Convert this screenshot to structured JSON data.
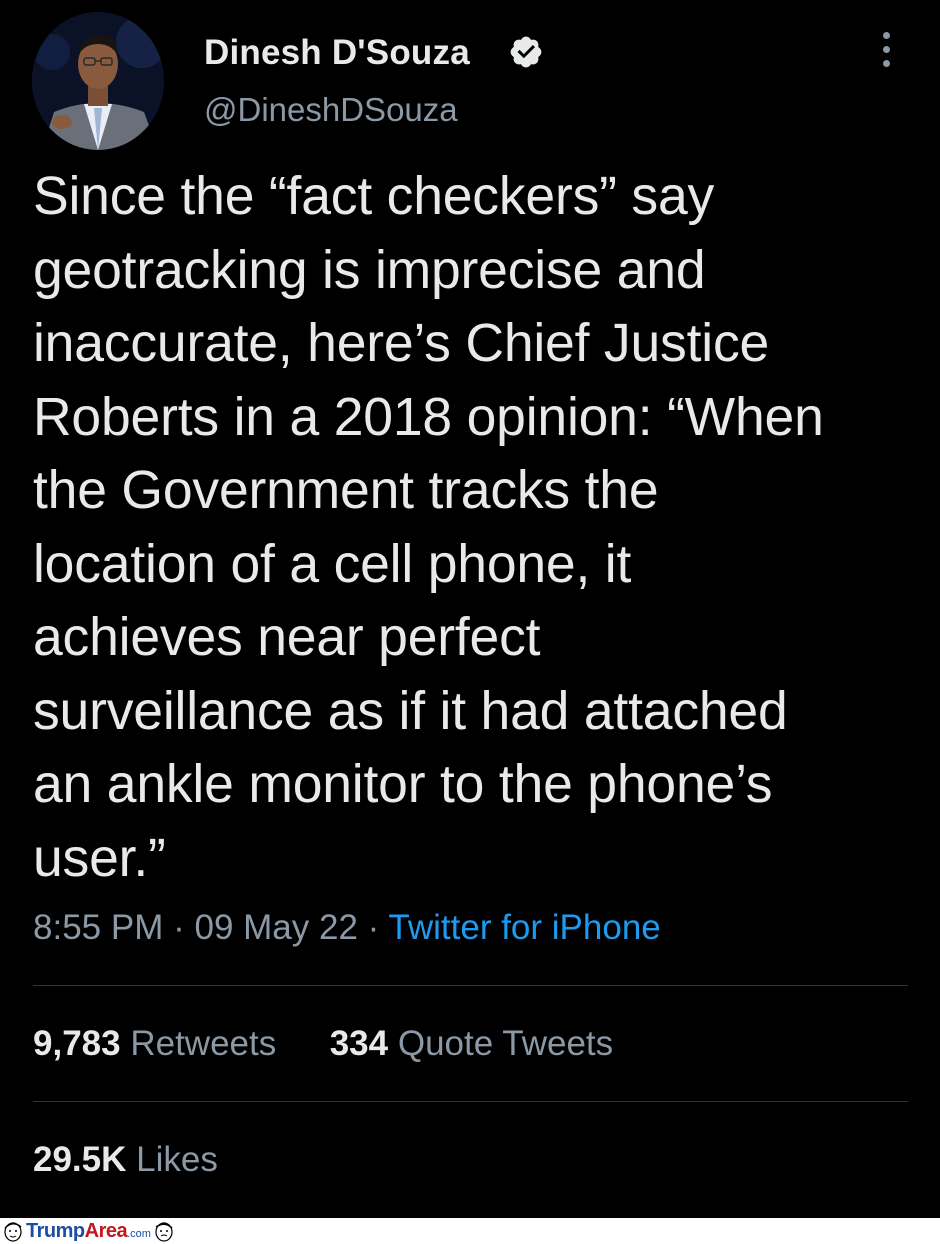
{
  "author": {
    "display_name": "Dinesh D'Souza",
    "handle": "@DineshDSouza",
    "verified": true
  },
  "tweet": {
    "text": "Since the “fact checkers” say\ngeotracking is imprecise and\ninaccurate, here’s Chief Justice\nRoberts in a 2018 opinion: “When\nthe Government tracks the\nlocation of a cell phone, it\nachieves near perfect\nsurveillance as if it had attached\nan ankle monitor to the phone’s\nuser.”",
    "time": "8:55 PM",
    "date": "09 May 22",
    "separator": "·",
    "source": "Twitter for iPhone"
  },
  "stats": {
    "retweets_count": "9,783",
    "retweets_label": "Retweets",
    "quotes_count": "334",
    "quotes_label": "Quote Tweets",
    "likes_count": "29.5K",
    "likes_label": "Likes"
  },
  "watermark": {
    "brand_part1": "Trump",
    "brand_part2": "Area",
    "suffix": ".com"
  },
  "colors": {
    "background": "#000000",
    "text_primary": "#e7e9ea",
    "text_secondary": "#8b98a5",
    "link": "#1d9bf0",
    "verified_badge": "#e7e9ea"
  },
  "icons": {
    "verified": "verified-badge-icon",
    "more": "more-options-icon"
  }
}
